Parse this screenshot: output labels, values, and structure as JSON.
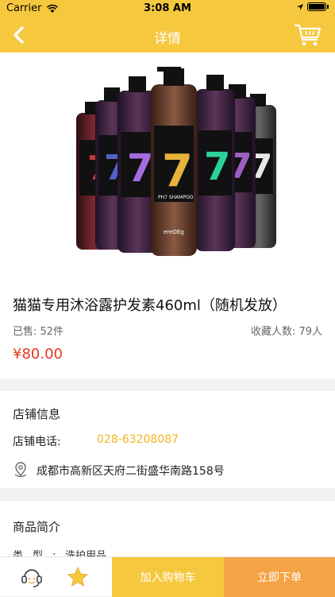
{
  "status_bar": {
    "carrier": "Carrier",
    "time": "3:08 AM"
  },
  "nav": {
    "title": "详情"
  },
  "product": {
    "title": "猫猫专用沐浴露护发素460ml（随机发放）",
    "sold": "已售: 52件",
    "favorites": "收藏人数: 79人",
    "price": "¥80.00"
  },
  "store": {
    "heading": "店铺信息",
    "tel_label": "店铺电话:",
    "tel": "028-63208087",
    "address": "成都市高新区天府二街盛华南路158号"
  },
  "description": {
    "heading": "商品简介",
    "type_label": "类型:",
    "type_value": "洗护用品"
  },
  "bottom_bar": {
    "add_to_cart": "加入购物车",
    "buy_now": "立即下单"
  },
  "colors": {
    "accent": "#f6c83e",
    "buy": "#f4a445",
    "price": "#e8361c",
    "phone": "#f4b323"
  },
  "icons": [
    "back-arrow-icon",
    "cart-icon",
    "location-pin-icon",
    "customer-service-icon",
    "favorite-star-icon"
  ]
}
